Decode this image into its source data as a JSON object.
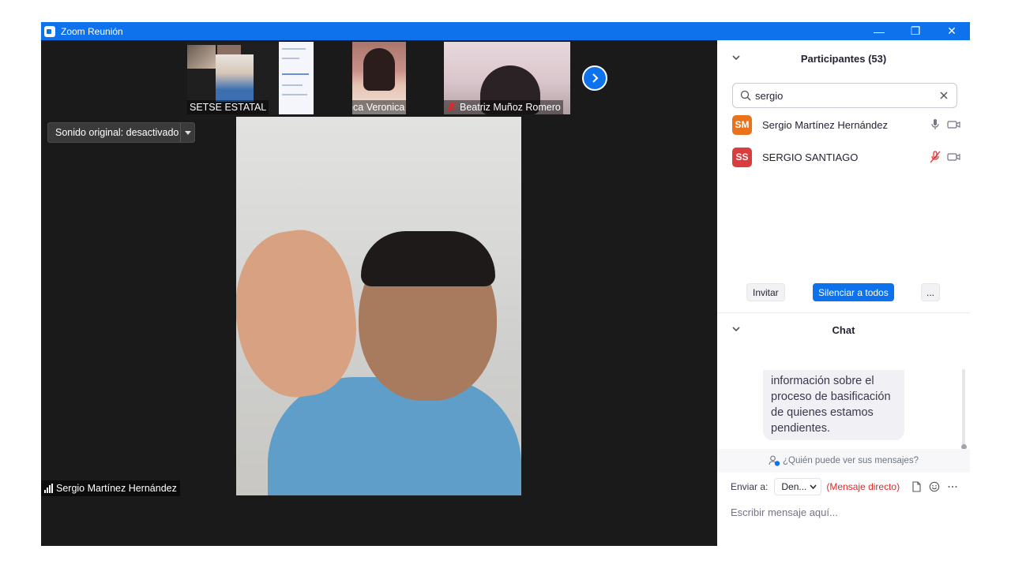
{
  "window": {
    "title": "Zoom Reunión",
    "minimize": "—",
    "restore": "❐",
    "close": "✕"
  },
  "gallery": [
    {
      "name": "SETSE ESTATAL",
      "muted": false
    },
    {
      "name": "Blanca Veronica Gonz...",
      "muted": true
    },
    {
      "name": "Beatriz Muñoz Romero",
      "muted": true
    }
  ],
  "sound": {
    "label": "Sonido original: desactivado"
  },
  "speaker": {
    "name": "Sergio Martínez Hernández"
  },
  "participants": {
    "title": "Participantes (53)",
    "search_value": "sergio",
    "list": [
      {
        "initials": "SM",
        "name": "Sergio Martínez Hernández",
        "color": "#e8731c",
        "muted": false
      },
      {
        "initials": "SS",
        "name": "SERGIO SANTIAGO",
        "color": "#d93d3d",
        "muted": true
      }
    ],
    "invite": "Invitar",
    "mute_all": "Silenciar a todos",
    "more": "..."
  },
  "chat": {
    "title": "Chat",
    "message": "información sobre el proceso de basificación de quienes estamos pendientes.",
    "who_sees": "¿Quién puede ver sus mensajes?",
    "send_to_label": "Enviar a:",
    "recipient": "Den...",
    "direct": "(Mensaje directo)",
    "placeholder": "Escribir mensaje aquí..."
  },
  "colors": {
    "accent": "#0e72ed",
    "mute_red": "#e02828"
  }
}
